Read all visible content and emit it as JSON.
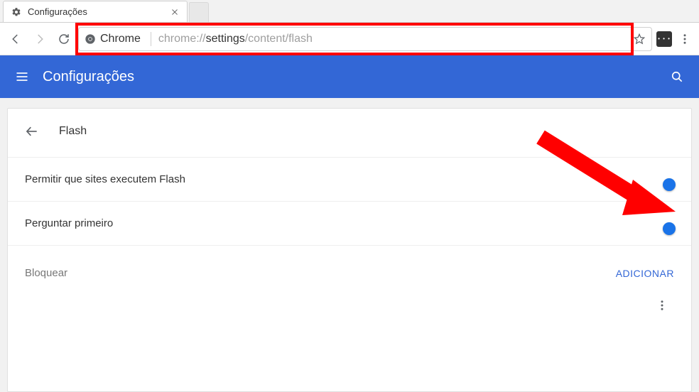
{
  "tab": {
    "title": "Configurações"
  },
  "omnibox": {
    "scheme_label": "Chrome",
    "url_prefix": "chrome://",
    "url_strong": "settings",
    "url_suffix": "/content/flash"
  },
  "header": {
    "title": "Configurações"
  },
  "page": {
    "section_title": "Flash"
  },
  "rows": {
    "allow": {
      "label": "Permitir que sites executem Flash",
      "on": true
    },
    "ask_first": {
      "label": "Perguntar primeiro",
      "on": true
    }
  },
  "block_section": {
    "label": "Bloquear",
    "add_button": "ADICIONAR"
  }
}
